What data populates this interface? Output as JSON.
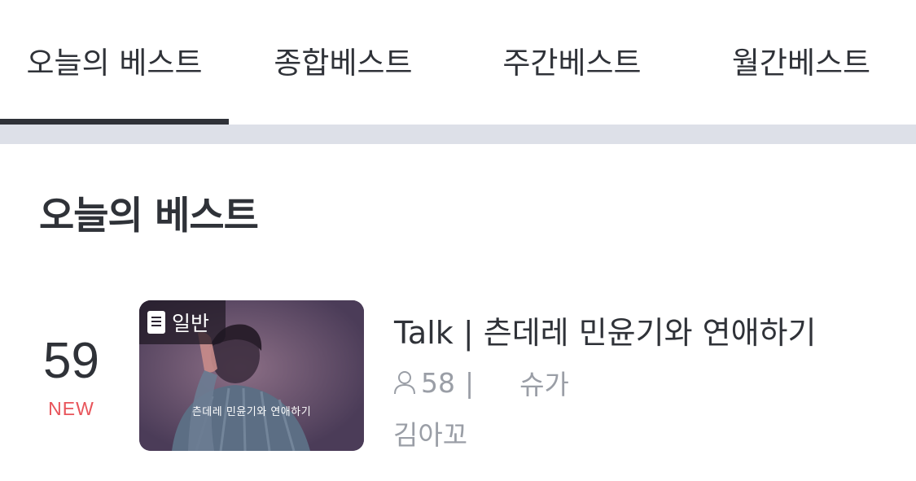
{
  "tabs": [
    {
      "label": "오늘의 베스트",
      "active": true
    },
    {
      "label": "종합베스트",
      "active": false
    },
    {
      "label": "주간베스트",
      "active": false
    },
    {
      "label": "월간베스트",
      "active": false
    }
  ],
  "section": {
    "title": "오늘의 베스트"
  },
  "items": [
    {
      "rank": "59",
      "rank_badge": "NEW",
      "type_badge": "일반",
      "thumbnail_caption": "츤데레 민윤기와 연애하기",
      "title": "Talk | 츤데레 민윤기와 연애하기",
      "member_count": "58",
      "separator": "|",
      "tag": "슈가",
      "author": "김아꼬"
    }
  ],
  "colors": {
    "text_primary": "#2f3238",
    "text_secondary": "#9a9ea6",
    "badge_new": "#e8545a",
    "divider": "#dde0e8",
    "tab_indicator": "#2f3238"
  }
}
